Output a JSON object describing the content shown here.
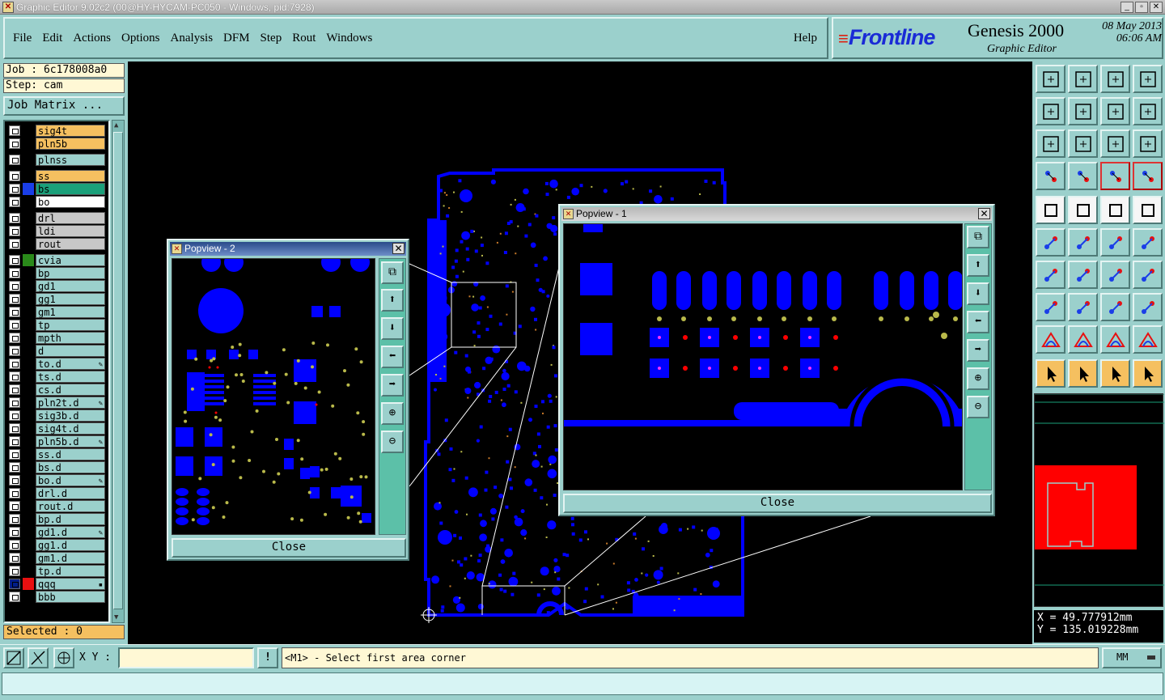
{
  "window": {
    "title": "Graphic Editor 9.02c2 (00@HY-HYCAM-PC050 - Windows, pid:7928)"
  },
  "menu": [
    "File",
    "Edit",
    "Actions",
    "Options",
    "Analysis",
    "DFM",
    "Step",
    "Rout",
    "Windows"
  ],
  "help_label": "Help",
  "brand": {
    "logo": "Frontline",
    "product": "Genesis 2000",
    "subtitle": "Graphic Editor",
    "date": "08 May 2013",
    "time": "06:06 AM"
  },
  "job": {
    "job_line": "Job : 6c178008a0",
    "step_line": "Step: cam",
    "job_matrix_label": "Job Matrix ..."
  },
  "layers": [
    {
      "name": "sig4t",
      "color": "#f5c060",
      "swatch": "#000000",
      "checked": false,
      "mark": ""
    },
    {
      "name": "pln5b",
      "color": "#f5c060",
      "swatch": "#000000",
      "checked": false,
      "mark": ""
    },
    {
      "name": "plnss",
      "color": "#9bd0cc",
      "swatch": "#000000",
      "checked": false,
      "mark": ""
    },
    {
      "name": "ss",
      "color": "#f5c060",
      "swatch": "#000000",
      "checked": false,
      "mark": ""
    },
    {
      "name": "bs",
      "color": "#1aa07a",
      "swatch": "#1a3ee8",
      "checked": false,
      "mark": ""
    },
    {
      "name": "bo",
      "color": "#ffffff",
      "swatch": "#000000",
      "checked": false,
      "mark": ""
    },
    {
      "name": "drl",
      "color": "#c8c8c8",
      "swatch": "#000000",
      "checked": false,
      "mark": ""
    },
    {
      "name": "ldi",
      "color": "#c8c8c8",
      "swatch": "#000000",
      "checked": false,
      "mark": ""
    },
    {
      "name": "rout",
      "color": "#c8c8c8",
      "swatch": "#000000",
      "checked": false,
      "mark": ""
    },
    {
      "name": "cvia",
      "color": "#9bd0cc",
      "swatch": "#2a8a1a",
      "checked": false,
      "mark": ""
    },
    {
      "name": "bp",
      "color": "#9bd0cc",
      "swatch": "#000000",
      "checked": false,
      "mark": ""
    },
    {
      "name": "gd1",
      "color": "#9bd0cc",
      "swatch": "#000000",
      "checked": false,
      "mark": ""
    },
    {
      "name": "gg1",
      "color": "#9bd0cc",
      "swatch": "#000000",
      "checked": false,
      "mark": ""
    },
    {
      "name": "gm1",
      "color": "#9bd0cc",
      "swatch": "#000000",
      "checked": false,
      "mark": ""
    },
    {
      "name": "tp",
      "color": "#9bd0cc",
      "swatch": "#000000",
      "checked": false,
      "mark": ""
    },
    {
      "name": "mpth",
      "color": "#9bd0cc",
      "swatch": "#000000",
      "checked": false,
      "mark": ""
    },
    {
      "name": "d",
      "color": "#9bd0cc",
      "swatch": "#000000",
      "checked": false,
      "mark": ""
    },
    {
      "name": "to.d",
      "color": "#9bd0cc",
      "swatch": "#000000",
      "checked": false,
      "mark": "✎"
    },
    {
      "name": "ts.d",
      "color": "#9bd0cc",
      "swatch": "#000000",
      "checked": false,
      "mark": ""
    },
    {
      "name": "cs.d",
      "color": "#9bd0cc",
      "swatch": "#000000",
      "checked": false,
      "mark": ""
    },
    {
      "name": "pln2t.d",
      "color": "#9bd0cc",
      "swatch": "#000000",
      "checked": false,
      "mark": "✎"
    },
    {
      "name": "sig3b.d",
      "color": "#9bd0cc",
      "swatch": "#000000",
      "checked": false,
      "mark": ""
    },
    {
      "name": "sig4t.d",
      "color": "#9bd0cc",
      "swatch": "#000000",
      "checked": false,
      "mark": ""
    },
    {
      "name": "pln5b.d",
      "color": "#9bd0cc",
      "swatch": "#000000",
      "checked": false,
      "mark": "✎"
    },
    {
      "name": "ss.d",
      "color": "#9bd0cc",
      "swatch": "#000000",
      "checked": false,
      "mark": ""
    },
    {
      "name": "bs.d",
      "color": "#9bd0cc",
      "swatch": "#000000",
      "checked": false,
      "mark": ""
    },
    {
      "name": "bo.d",
      "color": "#9bd0cc",
      "swatch": "#000000",
      "checked": false,
      "mark": "✎"
    },
    {
      "name": "drl.d",
      "color": "#9bd0cc",
      "swatch": "#000000",
      "checked": false,
      "mark": ""
    },
    {
      "name": "rout.d",
      "color": "#9bd0cc",
      "swatch": "#000000",
      "checked": false,
      "mark": ""
    },
    {
      "name": "bp.d",
      "color": "#9bd0cc",
      "swatch": "#000000",
      "checked": false,
      "mark": ""
    },
    {
      "name": "gd1.d",
      "color": "#9bd0cc",
      "swatch": "#000000",
      "checked": false,
      "mark": "✎"
    },
    {
      "name": "gg1.d",
      "color": "#9bd0cc",
      "swatch": "#000000",
      "checked": false,
      "mark": ""
    },
    {
      "name": "gm1.d",
      "color": "#9bd0cc",
      "swatch": "#000000",
      "checked": false,
      "mark": ""
    },
    {
      "name": "tp.d",
      "color": "#9bd0cc",
      "swatch": "#000000",
      "checked": false,
      "mark": ""
    },
    {
      "name": "qqq",
      "color": "#9bd0cc",
      "swatch": "#e81010",
      "checked": true,
      "mark": "▪"
    },
    {
      "name": "bbb",
      "color": "#9bd0cc",
      "swatch": "#000000",
      "checked": false,
      "mark": ""
    }
  ],
  "selected_text": "Selected : 0",
  "popview2": {
    "title": "Popview - 2",
    "close_label": "Close"
  },
  "popview1": {
    "title": "Popview - 1",
    "close_label": "Close"
  },
  "coords": {
    "x": "X = 49.777912mm",
    "y": "Y = 135.019228mm"
  },
  "bottom": {
    "xy_label": "X Y :",
    "prompt": "<M1> - Select first area corner",
    "units": "MM"
  },
  "colors": {
    "board": "#0000ff",
    "pads_yellow": "#b9b94a",
    "accent_red": "#ff0000",
    "panel": "#9bd0cc"
  }
}
